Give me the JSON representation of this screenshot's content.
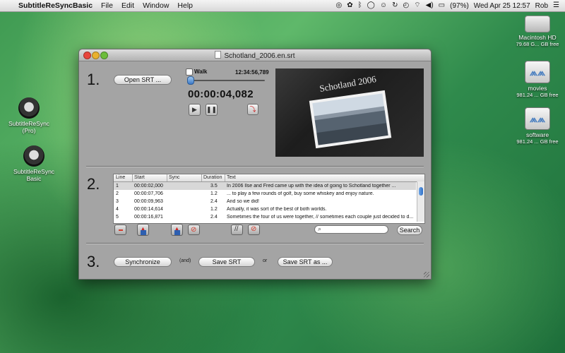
{
  "menubar": {
    "app_name": "SubtitleReSyncBasic",
    "menus": [
      "File",
      "Edit",
      "Window",
      "Help"
    ],
    "battery": "(97%)",
    "datetime": "Wed Apr 25  12:57",
    "user": "Rob"
  },
  "desktop": {
    "left_icons": [
      {
        "label": "SubtitleReSync",
        "sub": "(Pro)"
      },
      {
        "label": "SubtitleReSync",
        "sub": "Basic"
      }
    ],
    "right_icons": [
      {
        "label": "Macintosh HD",
        "sub": "79.68 G... GB free"
      },
      {
        "label": "movies",
        "sub": "981.24 ... GB free"
      },
      {
        "label": "software",
        "sub": "981.24 ... GB free"
      }
    ]
  },
  "window": {
    "title": "Schotland_2006.en.srt",
    "step1": "1.",
    "step2": "2.",
    "step3": "3.",
    "open_srt_label": "Open SRT ...",
    "walk_label": "Walk",
    "walk_time": "12:34:56,789",
    "current_time": "00:00:04,082",
    "video_title": "Schotland 2006",
    "table": {
      "columns": [
        "Line",
        "Start",
        "Sync",
        "Duration",
        "Text"
      ],
      "rows": [
        {
          "line": "1",
          "start": "00:00:02,000",
          "sync": "",
          "duration": "3.5",
          "text": "In 2006 Ilse and Fred came up with the idea of going to Schotland together ..."
        },
        {
          "line": "2",
          "start": "00:00:07,706",
          "sync": "",
          "duration": "1.2",
          "text": "... to play a few rounds of golf, buy some whiskey and enjoy nature."
        },
        {
          "line": "3",
          "start": "00:00:09,963",
          "sync": "",
          "duration": "2.4",
          "text": "And so we did!"
        },
        {
          "line": "4",
          "start": "00:00:14,614",
          "sync": "",
          "duration": "1.2",
          "text": "Actually, it was sort of the best of both worlds."
        },
        {
          "line": "5",
          "start": "00:00:16,871",
          "sync": "",
          "duration": "2.4",
          "text": "Sometimes the four of us were together, // sometimes each couple just decided to d..."
        }
      ]
    },
    "search_label": "Search",
    "synchronize_label": "Synchronize",
    "and_label": "(and)",
    "save_srt_label": "Save SRT",
    "or_label": "or",
    "save_srt_as_label": "Save SRT as ..."
  },
  "colors": {
    "window_bg": "#a4a4a4",
    "close": "#e8453c",
    "minimize": "#e9b12f",
    "zoom": "#6cbd3b",
    "delete_red": "#d23a2a",
    "selected_row": "#d8d8d8"
  }
}
